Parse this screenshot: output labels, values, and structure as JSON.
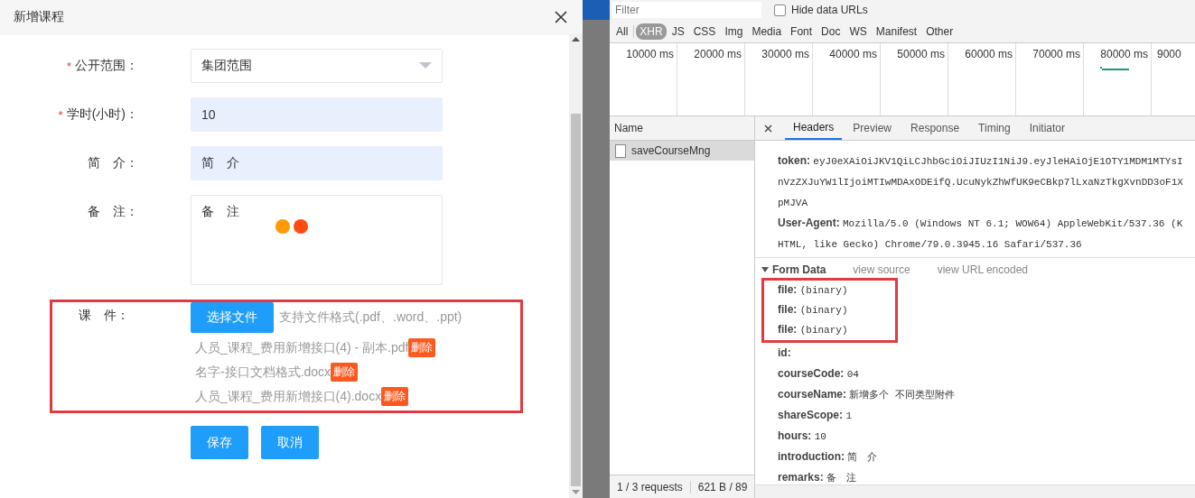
{
  "dialog": {
    "title": "新增课程",
    "required_mark": "*",
    "fields": [
      {
        "kind": "select",
        "required": true,
        "label": "公开范围：",
        "value": "集团范围",
        "autofilled": false
      },
      {
        "kind": "input",
        "required": true,
        "label": "学时(小时)：",
        "value": "10",
        "autofilled": true
      },
      {
        "kind": "input",
        "required": false,
        "label": "简　介：",
        "value": "简　介",
        "autofilled": true
      },
      {
        "kind": "textarea",
        "required": false,
        "label": "备　注：",
        "value": "备　注",
        "autofilled": false
      }
    ],
    "attachments": {
      "label": "课　件：",
      "button": "选择文件",
      "hint": "支持文件格式(.pdf、.word、.ppt)",
      "files": [
        {
          "name": "人员_课程_费用新增接口(4) - 副本.pdf",
          "action": "删除"
        },
        {
          "name": "名字-接口文档格式.docx",
          "action": "删除"
        },
        {
          "name": "人员_课程_费用新增接口(4).docx",
          "action": "删除"
        }
      ]
    },
    "buttons": [
      "保存",
      "取消"
    ]
  },
  "devtools": {
    "filter": {
      "placeholder": "Filter"
    },
    "hide_data_urls": {
      "label": "Hide data URLs",
      "checked": false
    },
    "type_filters": [
      {
        "label": "All",
        "selected": false
      },
      {
        "label": "XHR",
        "selected": true
      },
      {
        "label": "JS",
        "selected": false
      },
      {
        "label": "CSS",
        "selected": false
      },
      {
        "label": "Img",
        "selected": false
      },
      {
        "label": "Media",
        "selected": false
      },
      {
        "label": "Font",
        "selected": false
      },
      {
        "label": "Doc",
        "selected": false
      },
      {
        "label": "WS",
        "selected": false
      },
      {
        "label": "Manifest",
        "selected": false
      },
      {
        "label": "Other",
        "selected": false
      }
    ],
    "timeline_ticks": [
      "10000 ms",
      "20000 ms",
      "30000 ms",
      "40000 ms",
      "50000 ms",
      "60000 ms",
      "70000 ms",
      "80000 ms",
      "9000"
    ],
    "name_header": "Name",
    "requests": [
      {
        "name": "saveCourseMng",
        "selected": true
      }
    ],
    "detail_tabs": [
      {
        "label": "Headers",
        "selected": true
      },
      {
        "label": "Preview",
        "selected": false
      },
      {
        "label": "Response",
        "selected": false
      },
      {
        "label": "Timing",
        "selected": false
      },
      {
        "label": "Initiator",
        "selected": false
      }
    ],
    "headers": [
      {
        "name": "token:",
        "value": "eyJ0eXAiOiJKV1QiLCJhbGciOiJIUzI1NiJ9.eyJleHAiOjE1OTY1MDM1MTYsInVzZXJuYW1lIjoiMTIwMDAxODEifQ.UcuNykZhWfUK9eCBkp7lLxaNzTkgXvnDD3oF1XpMJVA"
      },
      {
        "name": "User-Agent:",
        "value": "Mozilla/5.0 (Windows NT 6.1; WOW64) AppleWebKit/537.36 (KHTML, like Gecko) Chrome/79.0.3945.16 Safari/537.36"
      }
    ],
    "form_data": {
      "title": "Form Data",
      "expanded": true,
      "links": [
        "view source",
        "view URL encoded"
      ],
      "highlighted": [
        {
          "name": "file:",
          "value": "(binary)"
        },
        {
          "name": "file:",
          "value": "(binary)"
        },
        {
          "name": "file:",
          "value": "(binary)"
        }
      ],
      "fields": [
        {
          "name": "id:"
        },
        {
          "name": "courseCode:",
          "value": "04"
        },
        {
          "name": "courseName:",
          "value": "新增多个  不同类型附件"
        },
        {
          "name": "shareScope:",
          "value": "1"
        },
        {
          "name": "hours:",
          "value": "10"
        },
        {
          "name": "introduction:",
          "value": "简　介"
        },
        {
          "name": "remarks:",
          "value": "备　注"
        }
      ]
    },
    "status": [
      "1 / 3 requests",
      "621 B / 89"
    ]
  }
}
